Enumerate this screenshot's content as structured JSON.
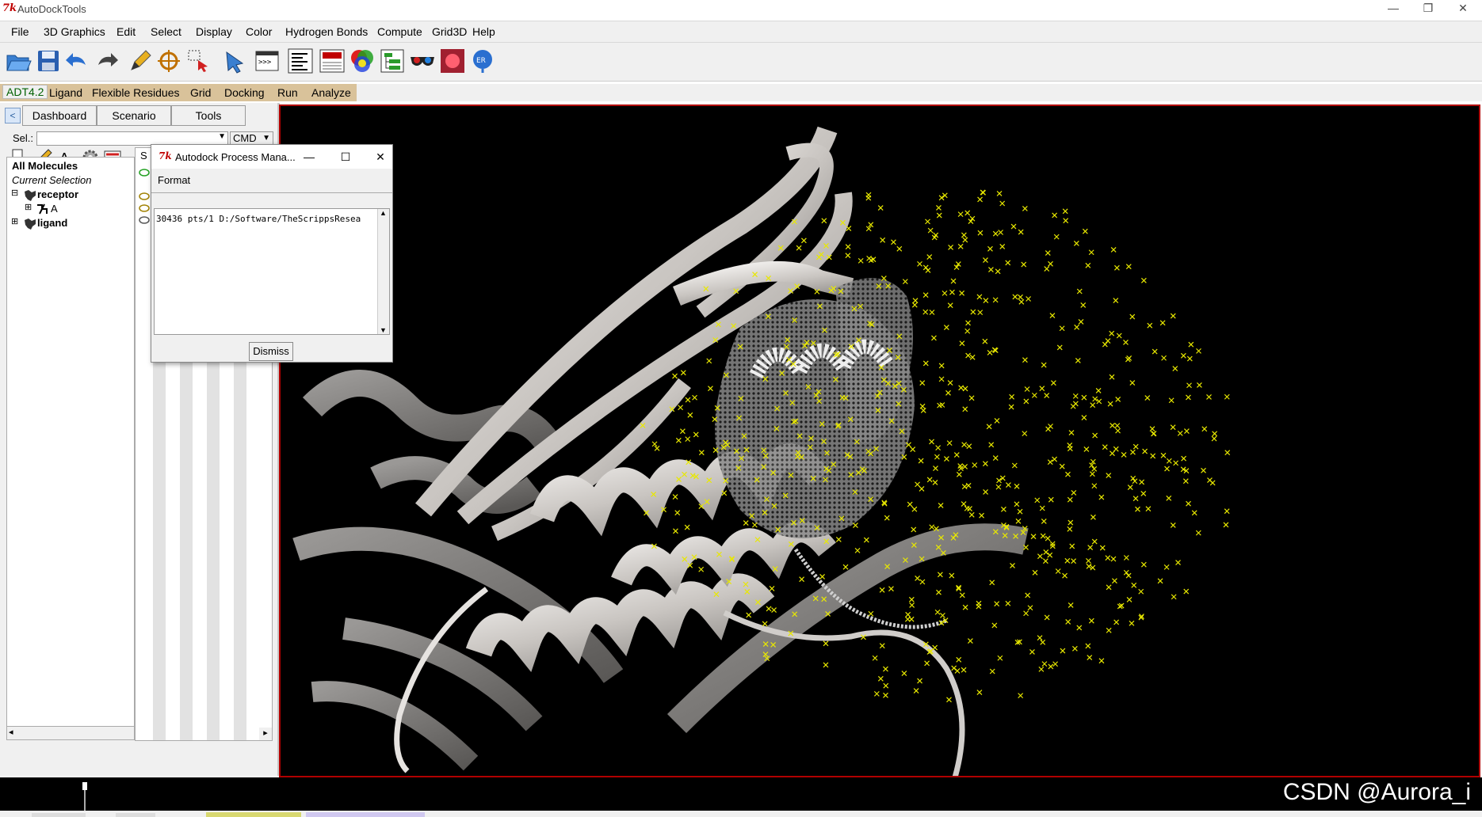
{
  "window": {
    "icon_text": "7k",
    "title": "AutoDockTools",
    "minimize": "—",
    "restore": "❐",
    "close": "✕"
  },
  "menubar": {
    "items": [
      "File",
      "3D Graphics",
      "Edit",
      "Select",
      "Display",
      "Color",
      "Hydrogen Bonds",
      "Compute",
      "Grid3D",
      "Help"
    ]
  },
  "toolbar": {
    "icons": [
      "open-folder-icon",
      "save-icon",
      "undo-icon",
      "redo-icon",
      "pencil-icon",
      "crosshair-icon",
      "selection-icon",
      "pointer-icon",
      "python-shell-icon",
      "text-align-icon",
      "dashboard-icon",
      "color-icon",
      "tree-icon",
      "stereo-glasses-icon",
      "render-icon",
      "autodock-icon"
    ]
  },
  "adt_bar": {
    "items": [
      "ADT4.2",
      "Ligand",
      "Flexible Residues",
      "Grid",
      "Docking",
      "Run",
      "Analyze"
    ]
  },
  "dashboard": {
    "tabs": [
      "Dashboard",
      "Scenario",
      "Tools"
    ],
    "sel_label": "Sel.:",
    "cmd_label": "CMD",
    "col_header": "S",
    "tree": {
      "all_molecules": "All Molecules",
      "current_selection": "Current Selection",
      "receptor": "receptor",
      "chain": "A",
      "ligand": "ligand",
      "expanded": "⊟",
      "collapsed": "⊞"
    }
  },
  "dialog": {
    "icon_text": "7k",
    "title": "Autodock Process Mana...",
    "menu": "Format",
    "process_line": "30436  pts/1 D:/Software/TheScrippsResea",
    "dismiss": "Dismiss",
    "minimize": "—",
    "maximize": "☐",
    "close": "✕"
  },
  "watermark": "CSDN @Aurora_i",
  "colors": {
    "viewer_bg": "#000000",
    "viewer_border": "#b00000",
    "ribbon": "#d8d4d0",
    "ligand_points": "#e8e800",
    "adt_strip": "#d9c29a"
  }
}
